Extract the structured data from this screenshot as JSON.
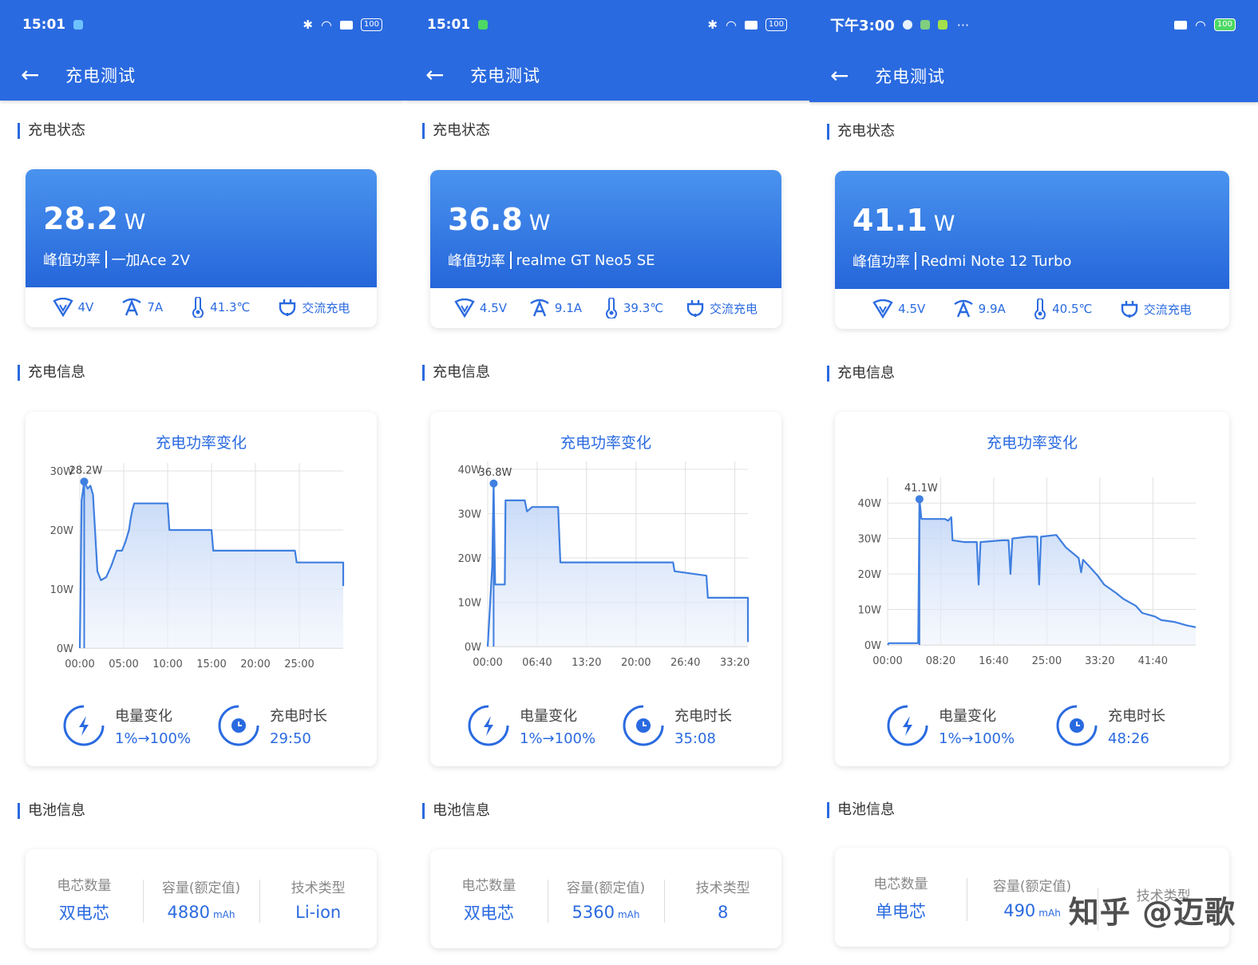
{
  "screens": [
    {
      "status": {
        "time": "15:01",
        "battery": "100"
      },
      "app_title": "充电测试",
      "sections": {
        "status": "充电状态",
        "info": "充电信息",
        "battery": "电池信息"
      },
      "peak": {
        "value": "28.2",
        "unit": "W",
        "label": "峰值功率",
        "device": "一加Ace 2V"
      },
      "metrics": {
        "voltage": "4V",
        "current": "7A",
        "temperature": "41.3℃",
        "charge_type": "交流充电"
      },
      "chart_title": "充电功率变化",
      "stats": {
        "change_label": "电量变化",
        "change_value": "1%→100%",
        "duration_label": "充电时长",
        "duration_value": "29:50"
      },
      "battery": {
        "cells_label": "电芯数量",
        "cells_value": "双电芯",
        "capacity_label": "容量(额定值)",
        "capacity_value": "4880",
        "capacity_unit": "mAh",
        "tech_label": "技术类型",
        "tech_value": "Li-ion"
      }
    },
    {
      "status": {
        "time": "15:01",
        "battery": "100"
      },
      "app_title": "充电测试",
      "sections": {
        "status": "充电状态",
        "info": "充电信息",
        "battery": "电池信息"
      },
      "peak": {
        "value": "36.8",
        "unit": "W",
        "label": "峰值功率",
        "device": "realme GT Neo5 SE"
      },
      "metrics": {
        "voltage": "4.5V",
        "current": "9.1A",
        "temperature": "39.3℃",
        "charge_type": "交流充电"
      },
      "chart_title": "充电功率变化",
      "stats": {
        "change_label": "电量变化",
        "change_value": "1%→100%",
        "duration_label": "充电时长",
        "duration_value": "35:08"
      },
      "battery": {
        "cells_label": "电芯数量",
        "cells_value": "双电芯",
        "capacity_label": "容量(额定值)",
        "capacity_value": "5360",
        "capacity_unit": "mAh",
        "tech_label": "技术类型",
        "tech_value": "8"
      }
    },
    {
      "status": {
        "time": "下午3:00",
        "battery": "100"
      },
      "app_title": "充电测试",
      "sections": {
        "status": "充电状态",
        "info": "充电信息",
        "battery": "电池信息"
      },
      "peak": {
        "value": "41.1",
        "unit": "W",
        "label": "峰值功率",
        "device": "Redmi Note 12 Turbo"
      },
      "metrics": {
        "voltage": "4.5V",
        "current": "9.9A",
        "temperature": "40.5℃",
        "charge_type": "交流充电"
      },
      "chart_title": "充电功率变化",
      "stats": {
        "change_label": "电量变化",
        "change_value": "1%→100%",
        "duration_label": "充电时长",
        "duration_value": "48:26"
      },
      "battery": {
        "cells_label": "电芯数量",
        "cells_value": "单电芯",
        "capacity_label": "容量(额定值)",
        "capacity_value": "490",
        "capacity_unit": "mAh",
        "tech_label": "技术类型",
        "tech_value": ""
      }
    }
  ],
  "watermark": "知乎 @迈歌",
  "colors": {
    "primary": "#2a6ae0",
    "card_gradient_top": "#4a93ef",
    "card_gradient_bottom": "#2566da",
    "line": "#3f7fe0"
  },
  "chart_data": [
    {
      "type": "area",
      "title": "充电功率变化",
      "xlabel": "",
      "ylabel": "",
      "x_ticks": [
        "00:00",
        "05:00",
        "10:00",
        "15:00",
        "20:00",
        "25:00"
      ],
      "y_ticks": [
        "0W",
        "10W",
        "20W",
        "30W"
      ],
      "xlim": [
        0,
        30
      ],
      "ylim": [
        0,
        30
      ],
      "peak_label": "28.2W",
      "peak": [
        0.5,
        28.2
      ],
      "x": [
        0,
        0.2,
        0.5,
        0.9,
        1.2,
        1.5,
        2.0,
        2.4,
        3.0,
        3.6,
        4.2,
        4.8,
        5.2,
        5.6,
        5.8,
        6.0,
        6.2,
        6.4,
        9.0,
        10.0,
        10.2,
        15.0,
        15.2,
        19.8,
        20.0,
        20.2,
        24.5,
        24.7,
        30.0,
        30.0
      ],
      "y": [
        0,
        25.0,
        28.2,
        27.0,
        27.5,
        26.0,
        13.0,
        11.5,
        12.0,
        14.0,
        16.5,
        16.5,
        18.0,
        20.0,
        22.0,
        23.5,
        24.5,
        24.5,
        24.5,
        24.5,
        20.0,
        20.0,
        16.5,
        16.5,
        16.5,
        16.5,
        16.5,
        14.5,
        14.5,
        10.5
      ]
    },
    {
      "type": "area",
      "title": "充电功率变化",
      "xlabel": "",
      "ylabel": "",
      "x_ticks": [
        "00:00",
        "06:40",
        "13:20",
        "20:00",
        "26:40",
        "33:20"
      ],
      "y_ticks": [
        "0W",
        "10W",
        "20W",
        "30W",
        "40W"
      ],
      "xlim": [
        0,
        35.1
      ],
      "ylim": [
        0,
        40
      ],
      "peak_label": "36.8W",
      "peak": [
        0.8,
        36.8
      ],
      "x": [
        0,
        0.6,
        0.8,
        1.0,
        2.3,
        2.4,
        5.0,
        5.3,
        6.0,
        9.5,
        9.8,
        25.0,
        25.2,
        29.5,
        29.7,
        35.1,
        35.1
      ],
      "y": [
        0,
        18.0,
        36.8,
        14.0,
        14.0,
        33.0,
        33.0,
        30.5,
        31.5,
        31.5,
        19.0,
        19.0,
        17.0,
        16.0,
        11.0,
        11.0,
        1.0
      ]
    },
    {
      "type": "area",
      "title": "充电功率变化",
      "xlabel": "",
      "ylabel": "",
      "x_ticks": [
        "00:00",
        "08:20",
        "16:40",
        "25:00",
        "33:20",
        "41:40"
      ],
      "y_ticks": [
        "0W",
        "10W",
        "20W",
        "30W",
        "40W"
      ],
      "xlim": [
        0,
        48.4
      ],
      "ylim": [
        0,
        45
      ],
      "peak_label": "41.1W",
      "peak": [
        5.0,
        41.1
      ],
      "x": [
        0,
        0.2,
        4.8,
        5.0,
        5.3,
        9.0,
        9.5,
        10.0,
        10.2,
        12.0,
        14.0,
        14.3,
        14.6,
        18.0,
        19.0,
        19.3,
        19.6,
        22.0,
        23.5,
        23.8,
        24.1,
        26.5,
        28.0,
        30.0,
        30.4,
        30.7,
        31.5,
        33.0,
        34.0,
        36.0,
        37.0,
        39.0,
        40.0,
        42.0,
        43.0,
        45.0,
        47.0,
        48.4
      ],
      "y": [
        0,
        0.5,
        0.5,
        41.1,
        35.5,
        35.5,
        35.0,
        36.0,
        29.5,
        29.0,
        29.0,
        17.0,
        29.0,
        29.5,
        29.5,
        20.0,
        30.0,
        30.5,
        30.5,
        17.0,
        30.5,
        31.0,
        27.5,
        24.5,
        20.5,
        24.0,
        22.5,
        19.5,
        17.0,
        14.5,
        13.0,
        11.0,
        9.0,
        8.0,
        7.0,
        6.5,
        5.5,
        5.0
      ]
    }
  ]
}
